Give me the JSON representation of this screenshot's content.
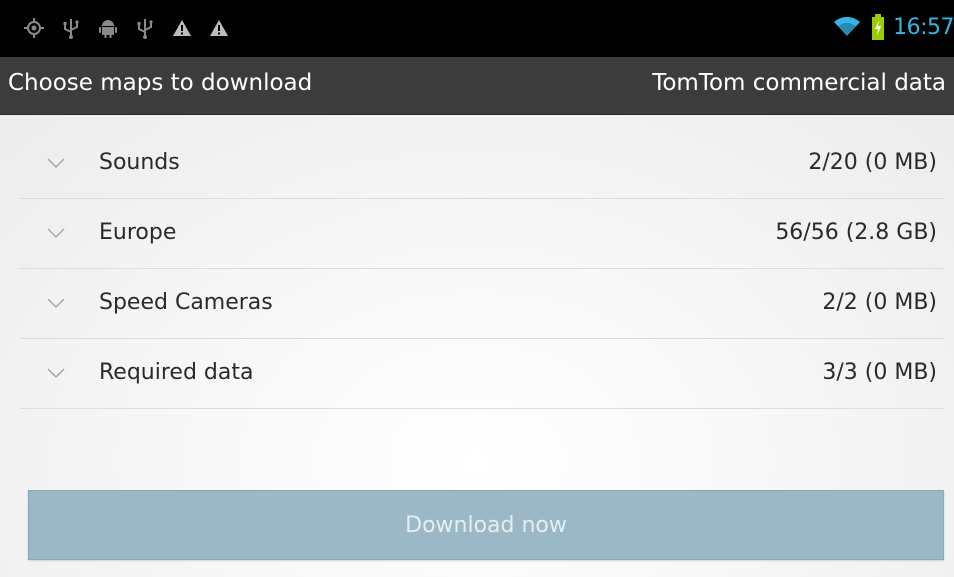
{
  "status_bar": {
    "left_icons": [
      "gps-icon",
      "usb-icon",
      "android-debug-icon",
      "usb-icon",
      "warning-icon",
      "warning-icon"
    ],
    "wifi_icon": "wifi-icon",
    "battery_icon": "battery-charging-icon",
    "time": "16:57",
    "accent_color": "#33b5e5"
  },
  "header": {
    "title": "Choose maps to download",
    "subtitle": "TomTom commercial data"
  },
  "list": {
    "items": [
      {
        "label": "Sounds",
        "value": "2/20 (0 MB)",
        "icon": "chevron-down-icon"
      },
      {
        "label": "Europe",
        "value": "56/56 (2.8 GB)",
        "icon": "chevron-down-icon"
      },
      {
        "label": "Speed Cameras",
        "value": "2/2 (0 MB)",
        "icon": "chevron-down-icon"
      },
      {
        "label": "Required data",
        "value": "3/3 (0 MB)",
        "icon": "chevron-down-icon"
      }
    ]
  },
  "actions": {
    "download_label": "Download now",
    "download_color": "#9ab8c6"
  }
}
